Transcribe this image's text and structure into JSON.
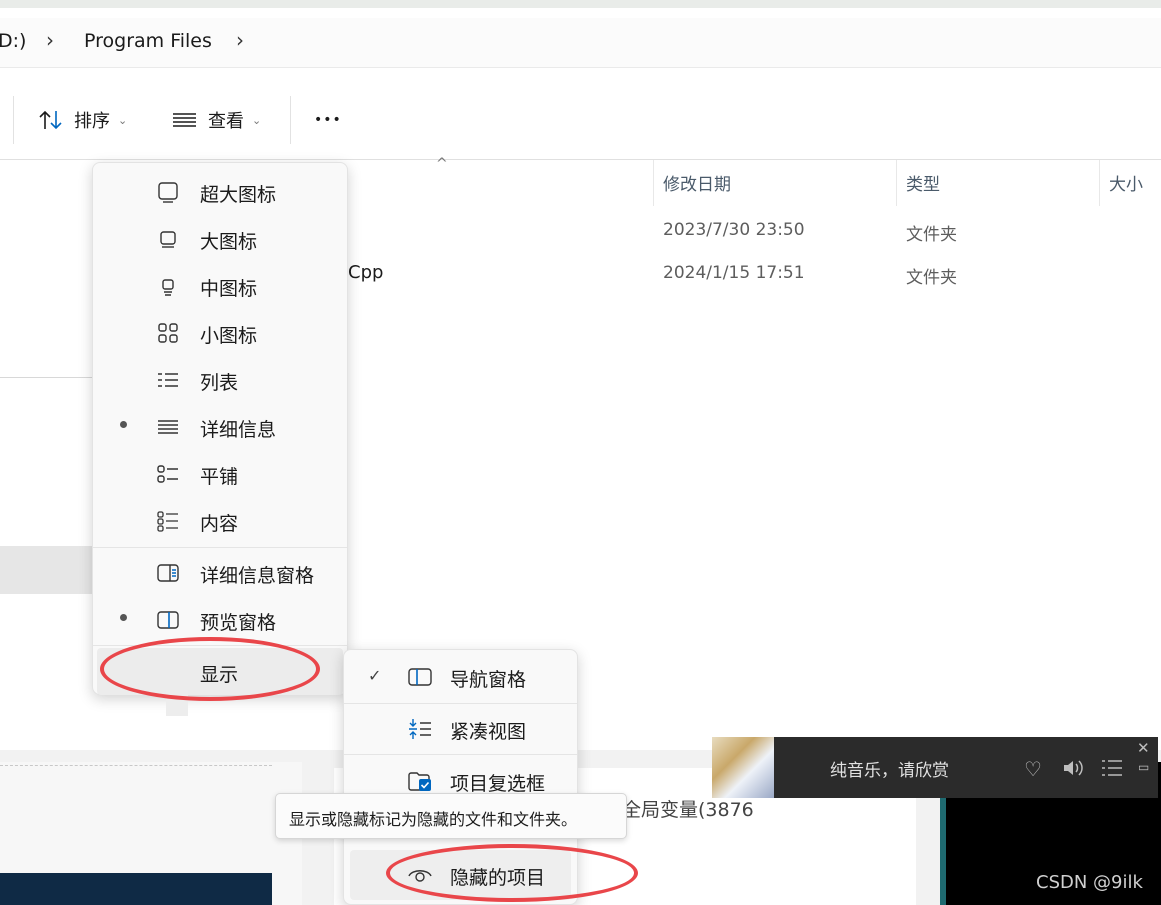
{
  "address": {
    "drive_fragment": "D:)",
    "folder": "Program Files"
  },
  "toolbar": {
    "sort_label": "排序",
    "view_label": "查看",
    "more_label": "•••"
  },
  "columns": {
    "modified": "修改日期",
    "type": "类型",
    "size": "大小"
  },
  "files": [
    {
      "name": "",
      "modified": "2023/7/30 23:50",
      "type": "文件夹"
    },
    {
      "name": "Cpp",
      "modified": "2024/1/15 17:51",
      "type": "文件夹"
    }
  ],
  "view_menu": {
    "items": [
      {
        "label": "超大图标",
        "icon": "extra-large-icons-icon",
        "selected": false
      },
      {
        "label": "大图标",
        "icon": "large-icons-icon",
        "selected": false
      },
      {
        "label": "中图标",
        "icon": "medium-icons-icon",
        "selected": false
      },
      {
        "label": "小图标",
        "icon": "small-icons-icon",
        "selected": false
      },
      {
        "label": "列表",
        "icon": "list-icon",
        "selected": false
      },
      {
        "label": "详细信息",
        "icon": "details-icon",
        "selected": true
      },
      {
        "label": "平铺",
        "icon": "tiles-icon",
        "selected": false
      },
      {
        "label": "内容",
        "icon": "content-icon",
        "selected": false
      }
    ],
    "panes": [
      {
        "label": "详细信息窗格",
        "icon": "details-pane-icon",
        "selected": false
      },
      {
        "label": "预览窗格",
        "icon": "preview-pane-icon",
        "selected": true
      }
    ],
    "show_label": "显示"
  },
  "show_submenu": {
    "items": [
      {
        "label": "导航窗格",
        "icon": "navigation-pane-icon",
        "checked": true
      },
      {
        "label": "紧凑视图",
        "icon": "compact-view-icon",
        "checked": false
      },
      {
        "label": "项目复选框",
        "icon": "item-checkbox-icon",
        "checked": false
      },
      {
        "label": "隐藏的项目",
        "icon": "eye-icon",
        "checked": false
      }
    ]
  },
  "tooltip": "显示或隐藏标记为隐藏的文件和文件夹。",
  "background_doc_text": "全局变量(3876",
  "music_widget": {
    "text": "纯音乐，请欣赏"
  },
  "watermark": "CSDN @9ilk",
  "colors": {
    "annotation_red": "#e9464a",
    "accent_blue": "#0067c0"
  }
}
